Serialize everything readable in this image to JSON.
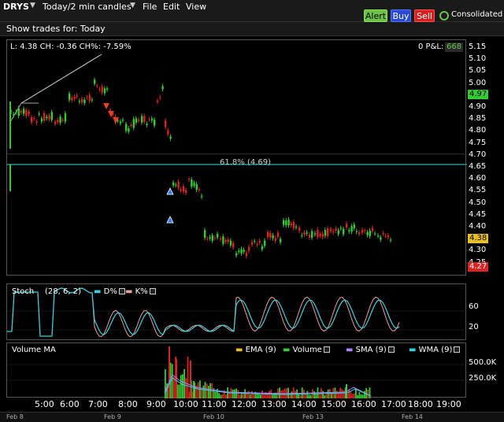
{
  "toolbar": {
    "symbol": "DRYS",
    "timeframe": "Today/2 min candles",
    "menu": [
      "File",
      "Edit",
      "View"
    ],
    "alert_label": "Alert",
    "buy_label": "Buy",
    "sell_label": "Sell",
    "consolidated_label": "Consolidated"
  },
  "trades": {
    "label": "Show trades for:",
    "value": "Today"
  },
  "price_panel": {
    "header": "L: 4.38 CH: -0.36 CH%: -7.59%",
    "pnl_label": "0 P&L:",
    "pnl_value": "668",
    "fib_label": "61.8% (4.69)",
    "yticks": [
      "5.15",
      "5.10",
      "5.05",
      "5.00",
      "4.95",
      "4.90",
      "4.85",
      "4.80",
      "4.75",
      "4.70",
      "4.65",
      "4.60",
      "4.55",
      "4.50",
      "4.45",
      "4.40",
      "4.35",
      "4.30",
      "4.25"
    ],
    "bid_label": "4.97",
    "last_label": "4.38",
    "ask_label": "4.27"
  },
  "stoch_panel": {
    "title": "Stoch",
    "params": "(28, 6, 2)",
    "d_label": "D%",
    "k_label": "K%",
    "yticks": [
      "60",
      "20"
    ]
  },
  "vol_panel": {
    "title": "Volume MA",
    "legend": [
      "EMA (9)",
      "Volume",
      "SMA (9)",
      "WMA (9)"
    ],
    "yticks": [
      "500.0K",
      "250.0K"
    ]
  },
  "xaxis": [
    "5:00",
    "6:00",
    "7:00",
    "8:00",
    "9:00",
    "10:00",
    "11:00",
    "12:00",
    "13:00",
    "14:00",
    "15:00",
    "16:00",
    "17:00",
    "18:00",
    "19:00"
  ],
  "datebar": [
    "Feb 8",
    "Feb 9",
    "Feb 10",
    "Feb 13",
    "Feb 14"
  ],
  "colors": {
    "up": "#33cc33",
    "down": "#dd2222",
    "fib": "#1a9a9a",
    "d_line": "#3ad0e0",
    "k_line": "#e8a0a0"
  }
}
